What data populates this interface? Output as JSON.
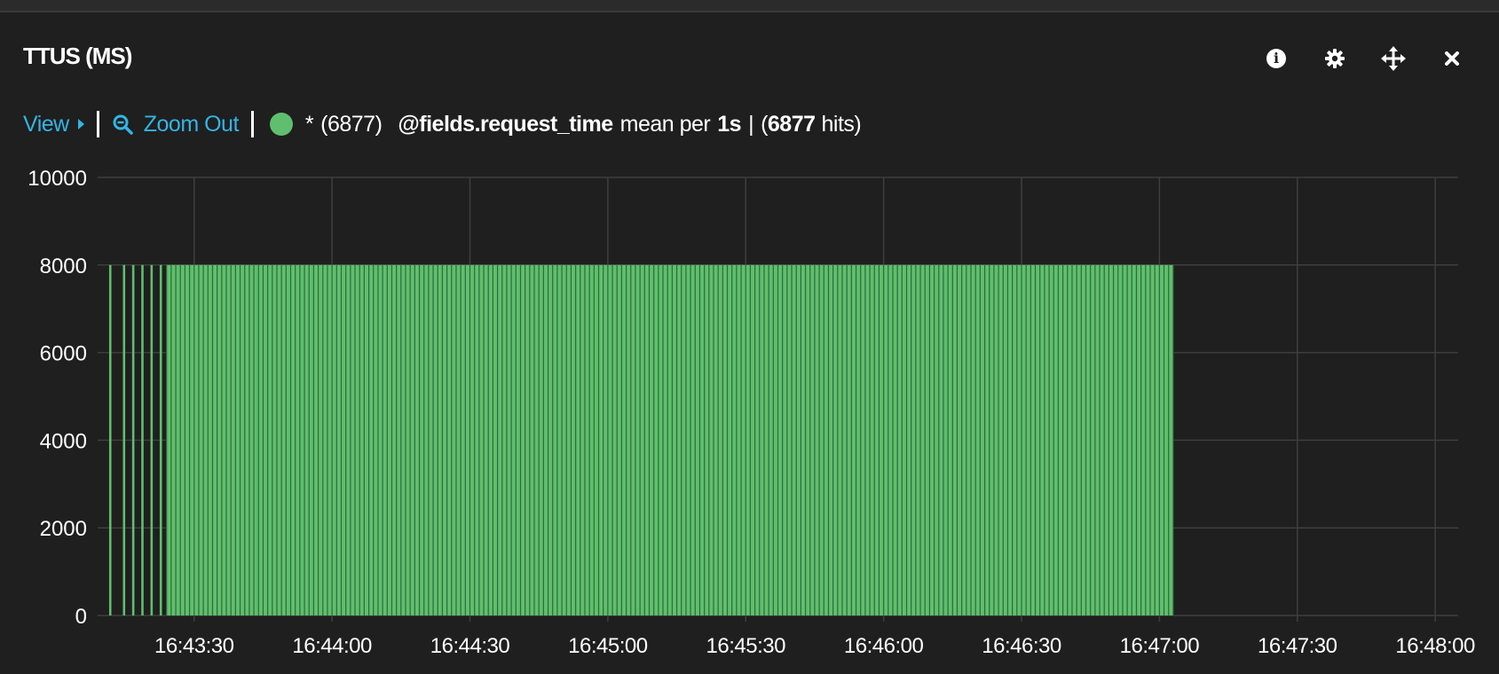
{
  "panel": {
    "title": "TTUS (MS)",
    "icons": [
      "info-icon",
      "gear-icon",
      "move-icon",
      "close-icon"
    ]
  },
  "toolbar": {
    "view_label": "View",
    "zoom_out_label": "Zoom Out"
  },
  "legend": {
    "color": "#5fbf6e",
    "query": "*",
    "query_count": "(6877)",
    "field": "@fields.request_time",
    "mode": "mean per",
    "interval": "1s",
    "separator": "|",
    "hits_open": "(",
    "hits_count": "6877",
    "hits_suffix": "hits)"
  },
  "chart_data": {
    "type": "bar",
    "series": [
      {
        "query": "* (6877)",
        "field": "@fields.request_time",
        "aggregate": "mean per 1s",
        "color": "#5fbf6e",
        "segments": [
          {
            "start": "16:43:11.5",
            "end": "16:43:12",
            "value": 8000,
            "step_s": 1
          },
          {
            "start": "16:43:14.5",
            "end": "16:43:15",
            "value": 8000,
            "step_s": 1
          },
          {
            "start": "16:43:16.5",
            "end": "16:43:17",
            "value": 8000,
            "step_s": 1
          },
          {
            "start": "16:43:18.5",
            "end": "16:43:19",
            "value": 8000,
            "step_s": 1
          },
          {
            "start": "16:43:20.5",
            "end": "16:43:21",
            "value": 8000,
            "step_s": 1
          },
          {
            "start": "16:43:22.5",
            "end": "16:43:23",
            "value": 8000,
            "step_s": 1
          },
          {
            "start": "16:43:24",
            "end": "16:47:03",
            "value": 8000,
            "step_s": 1
          }
        ]
      }
    ],
    "x_ticks": [
      "16:43:30",
      "16:44:00",
      "16:44:30",
      "16:45:00",
      "16:45:30",
      "16:46:00",
      "16:46:30",
      "16:47:00",
      "16:47:30",
      "16:48:00"
    ],
    "x_range": [
      "16:43:09",
      "16:48:05"
    ],
    "y_ticks": [
      0,
      2000,
      4000,
      6000,
      8000,
      10000
    ],
    "ylim": [
      0,
      10000
    ],
    "grid": true,
    "colors": {
      "bar": "#5fbf6e",
      "bar_edge": "#2f6a37",
      "grid": "#3e3e3e",
      "axis_text": "#ffffff",
      "background": "#1f1f1f"
    }
  }
}
